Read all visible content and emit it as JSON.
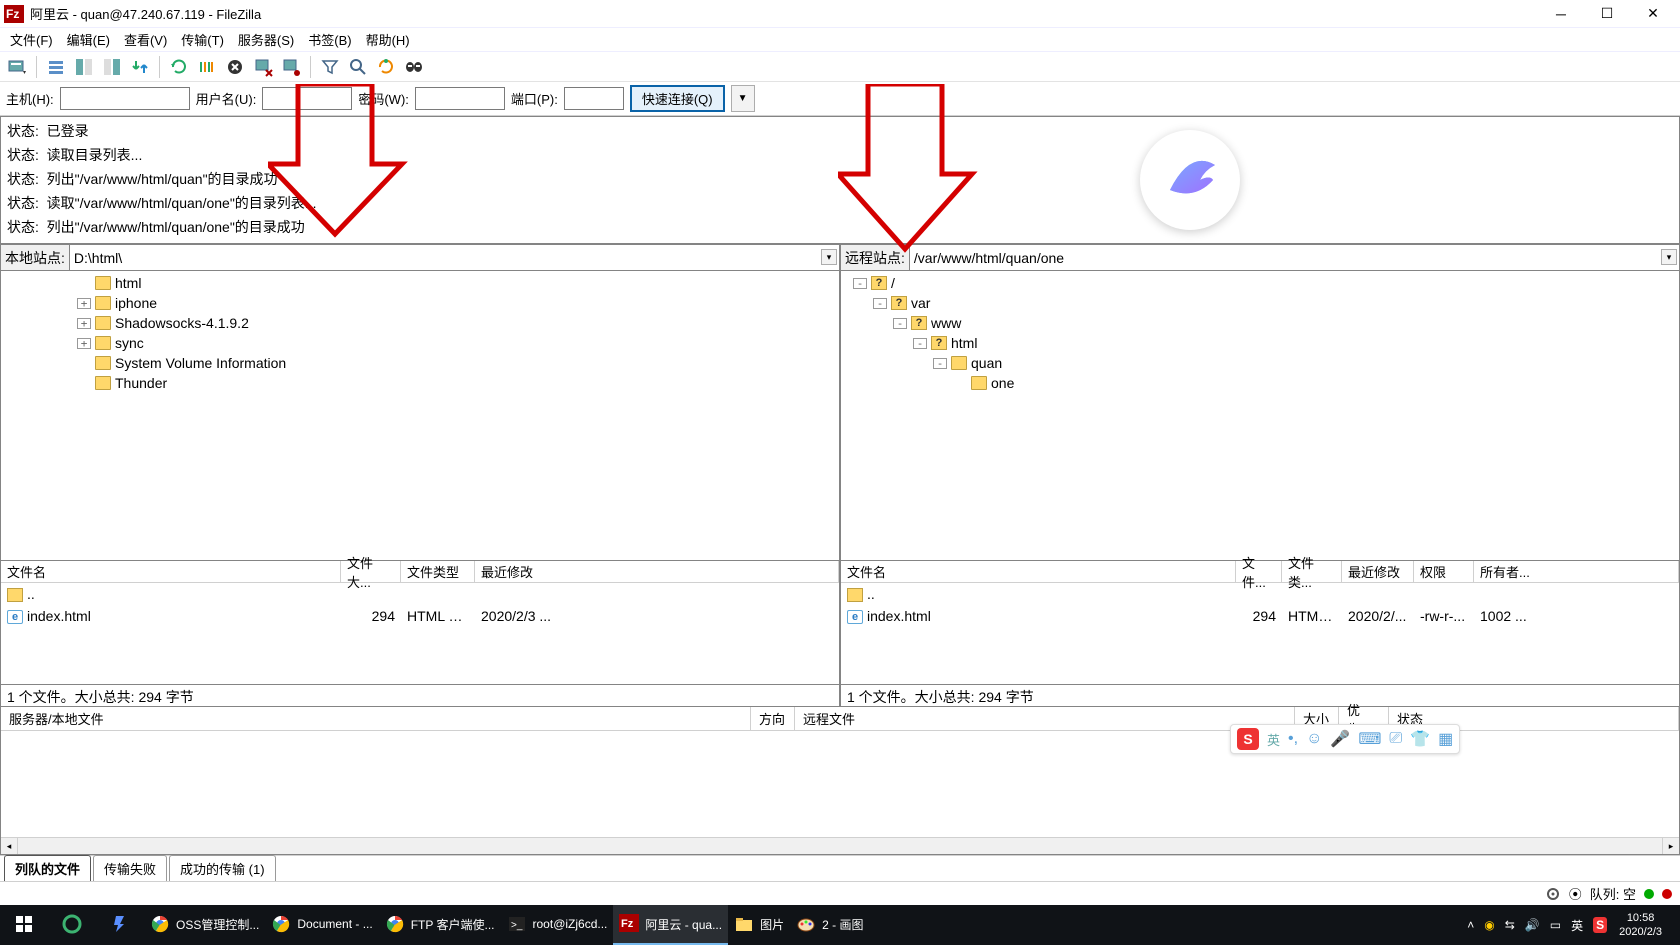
{
  "title": "阿里云 - quan@47.240.67.119 - FileZilla",
  "menu": {
    "file": "文件(F)",
    "edit": "编辑(E)",
    "view": "查看(V)",
    "transfer": "传输(T)",
    "server": "服务器(S)",
    "bookmark": "书签(B)",
    "help": "帮助(H)"
  },
  "quick": {
    "host_lbl": "主机(H):",
    "user_lbl": "用户名(U):",
    "pass_lbl": "密码(W):",
    "port_lbl": "端口(P):",
    "connect": "快速连接(Q)",
    "host": "",
    "user": "",
    "pass": "",
    "port": ""
  },
  "status": {
    "prefix": "状态:",
    "lines": [
      "已登录",
      "读取目录列表...",
      "列出\"/var/www/html/quan\"的目录成功",
      "读取\"/var/www/html/quan/one\"的目录列表...",
      "列出\"/var/www/html/quan/one\"的目录成功"
    ]
  },
  "local": {
    "title": "本地站点:",
    "path": "D:\\html\\",
    "tree": [
      "html",
      "iphone",
      "Shadowsocks-4.1.9.2",
      "sync",
      "System Volume Information",
      "Thunder"
    ],
    "cols": {
      "name": "文件名",
      "size": "文件大...",
      "type": "文件类型",
      "modified": "最近修改"
    },
    "files": [
      {
        "name": "..",
        "size": "",
        "type": "",
        "modified": "",
        "icon": "fold"
      },
      {
        "name": "index.html",
        "size": "294",
        "type": "HTML 文...",
        "modified": "2020/2/3 ...",
        "icon": "ie"
      }
    ],
    "status": "1 个文件。大小总共: 294 字节"
  },
  "remote": {
    "title": "远程站点:",
    "path": "/var/www/html/quan/one",
    "tree": [
      {
        "name": "/",
        "depth": 0
      },
      {
        "name": "var",
        "depth": 1
      },
      {
        "name": "www",
        "depth": 2
      },
      {
        "name": "html",
        "depth": 3
      },
      {
        "name": "quan",
        "depth": 4,
        "folder": true
      },
      {
        "name": "one",
        "depth": 5,
        "folder": true
      }
    ],
    "cols": {
      "name": "文件名",
      "size": "文件...",
      "type": "文件类...",
      "modified": "最近修改",
      "perm": "权限",
      "owner": "所有者..."
    },
    "files": [
      {
        "name": "..",
        "size": "",
        "type": "",
        "modified": "",
        "perm": "",
        "owner": "",
        "icon": "fold"
      },
      {
        "name": "index.html",
        "size": "294",
        "type": "HTML ...",
        "modified": "2020/2/...",
        "perm": "-rw-r-...",
        "owner": "1002 ...",
        "icon": "ie"
      }
    ],
    "status": "1 个文件。大小总共: 294 字节"
  },
  "queue": {
    "cols": {
      "local": "服务器/本地文件",
      "dir": "方向",
      "remote": "远程文件",
      "size": "大小",
      "prio": "优先...",
      "status": "状态"
    }
  },
  "tabs": {
    "queued": "列队的文件",
    "failed": "传输失败",
    "success": "成功的传输 (1)"
  },
  "appstatus": {
    "queue": "队列: 空"
  },
  "taskbar": {
    "items": [
      {
        "label": "OSS管理控制..."
      },
      {
        "label": "Document - ..."
      },
      {
        "label": "FTP 客户端使..."
      },
      {
        "label": "root@iZj6cd..."
      },
      {
        "label": "阿里云 - qua...",
        "active": true
      },
      {
        "label": "图片"
      },
      {
        "label": "2 - 画图"
      }
    ],
    "ime": "英",
    "time": "10:58",
    "date": "2020/2/3"
  },
  "ime_float": {
    "text": "英"
  }
}
